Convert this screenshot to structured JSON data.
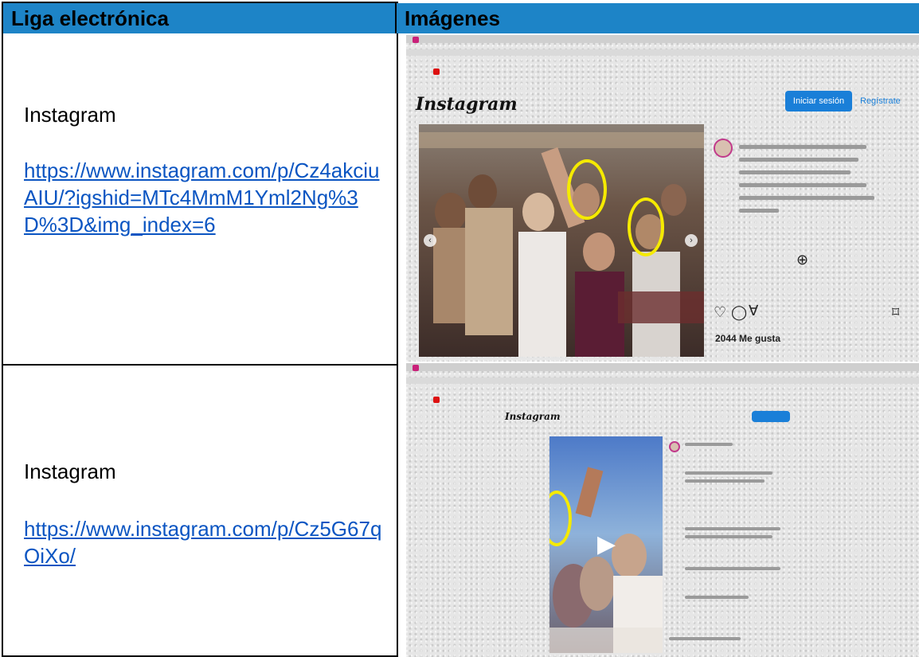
{
  "table": {
    "header_link": "Liga electrónica",
    "header_images": "Imágenes",
    "rows": [
      {
        "platform": "Instagram",
        "url": "https://www.instagram.com/p/Cz4akciuAIU/?igshid=MTc4MmM1Yml2Ng%3D%3D&img_index=6",
        "screenshot": {
          "logo": "Instagram",
          "login_button": "Iniciar sesión",
          "register_link": "Regístrate",
          "likes": "2044 Me gusta"
        }
      },
      {
        "platform": "Instagram",
        "url": "https://www.instagram.com/p/Cz5G67qOiXo/",
        "screenshot": {
          "logo": "Instagram"
        }
      }
    ]
  },
  "colors": {
    "header_bg": "#1d84c7",
    "link": "#0b55c2",
    "highlight_ring": "#f5ea00",
    "ig_blue": "#1a7fd8"
  }
}
